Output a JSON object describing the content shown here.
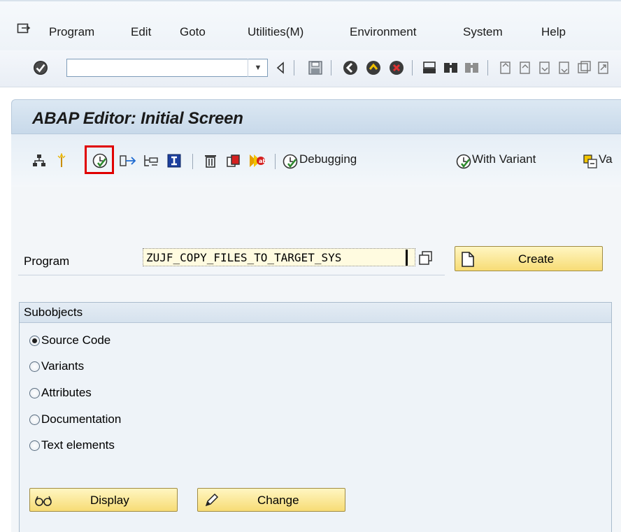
{
  "menu": {
    "items": [
      {
        "label": "Program"
      },
      {
        "label": "Edit"
      },
      {
        "label": "Goto"
      },
      {
        "label": "Utilities(M)"
      },
      {
        "label": "Environment"
      },
      {
        "label": "System"
      },
      {
        "label": "Help"
      }
    ]
  },
  "command_field": {
    "value": ""
  },
  "page": {
    "title": "ABAP Editor: Initial Screen"
  },
  "app_toolbar": {
    "debugging_label": "Debugging",
    "with_variant_label": "With Variant",
    "variants_label_partial": "Va",
    "highlighted_icon": "direct-processing-icon",
    "highlight_color": "#e00000"
  },
  "program": {
    "label": "Program",
    "value": "ZUJF_COPY_FILES_TO_TARGET_SYS",
    "create_label": "Create"
  },
  "subobjects": {
    "title": "Subobjects",
    "options": [
      {
        "label": "Source Code",
        "selected": true
      },
      {
        "label": "Variants",
        "selected": false
      },
      {
        "label": "Attributes",
        "selected": false
      },
      {
        "label": "Documentation",
        "selected": false
      },
      {
        "label": "Text elements",
        "selected": false
      }
    ],
    "display_label": "Display",
    "change_label": "Change"
  },
  "colors": {
    "accent_yellow": "#f7dc75",
    "header_blue": "#c8d9ea",
    "highlight_red": "#e00000"
  }
}
